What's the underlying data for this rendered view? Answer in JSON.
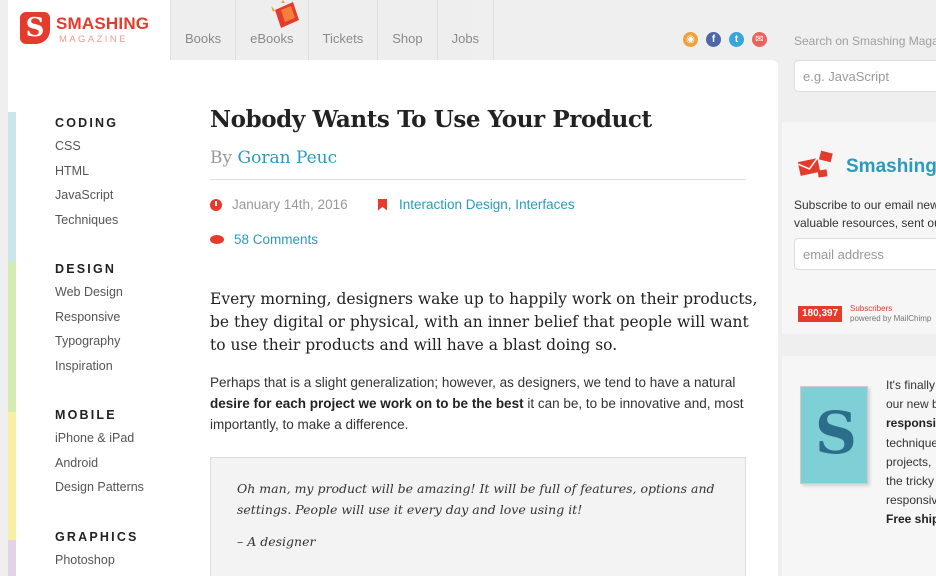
{
  "logo": {
    "title": "SMASHING",
    "subtitle": "MAGAZINE",
    "mark": "S"
  },
  "nav": {
    "items": [
      "Books",
      "eBooks",
      "Tickets",
      "Shop",
      "Jobs"
    ]
  },
  "social": [
    {
      "icon": "rss-icon",
      "color": "#f0a13a",
      "glyph": "◉"
    },
    {
      "icon": "facebook-icon",
      "color": "#4c69a6",
      "glyph": "f"
    },
    {
      "icon": "twitter-icon",
      "color": "#37a6dc",
      "glyph": "t"
    },
    {
      "icon": "email-icon",
      "color": "#e8635e",
      "glyph": "✉"
    }
  ],
  "search": {
    "label": "Search on Smashing Magazine",
    "placeholder": "e.g. JavaScript"
  },
  "categories": [
    {
      "title": "CODING",
      "color": "#c9e7e9",
      "links": [
        "CSS",
        "HTML",
        "JavaScript",
        "Techniques"
      ]
    },
    {
      "title": "DESIGN",
      "color": "#d4ecb4",
      "links": [
        "Web Design",
        "Responsive",
        "Typography",
        "Inspiration"
      ]
    },
    {
      "title": "MOBILE",
      "color": "#f6efa4",
      "links": [
        "iPhone & iPad",
        "Android",
        "Design Patterns"
      ]
    },
    {
      "title": "GRAPHICS",
      "color": "#e3d2e8",
      "links": [
        "Photoshop"
      ]
    }
  ],
  "article": {
    "title": "Nobody Wants To Use Your Product",
    "by": "By",
    "author": "Goran Peuc",
    "date": "January 14th, 2016",
    "categories": "Interaction Design, Interfaces",
    "comments": "58 Comments",
    "lead": "Every morning, designers wake up to happily work on their products, be they digital or physical, with an inner belief that people will want to use their products and will have a blast doing so.",
    "p1_before": "Perhaps that is a slight generalization; however, as designers, we tend to have a natural ",
    "p1_bold": "desire for each project we work on to be the best",
    "p1_after": " it can be, to be innovative and, most importantly, to make a difference.",
    "quote": "Oh man, my product will be amazing! It will be full of features, options and settings. People will use it every day and love using it!",
    "quote_attr": "– A designer"
  },
  "newsletter": {
    "title": "Smashing Newsletter",
    "line1": "Subscribe to our email newsletter for",
    "line2": "valuable resources, sent out every two weeks.",
    "placeholder": "email address",
    "count": "180,397",
    "count_label": "Subscribers",
    "powered": "powered by MailChimp"
  },
  "book_promo": {
    "l1": "It's finally here:",
    "l2": "our new book,",
    "l3": "responsive",
    "l4": "techniques",
    "l5": "projects,",
    "l6": "the tricky",
    "l7": "responsive",
    "l8": "Free shipping"
  }
}
